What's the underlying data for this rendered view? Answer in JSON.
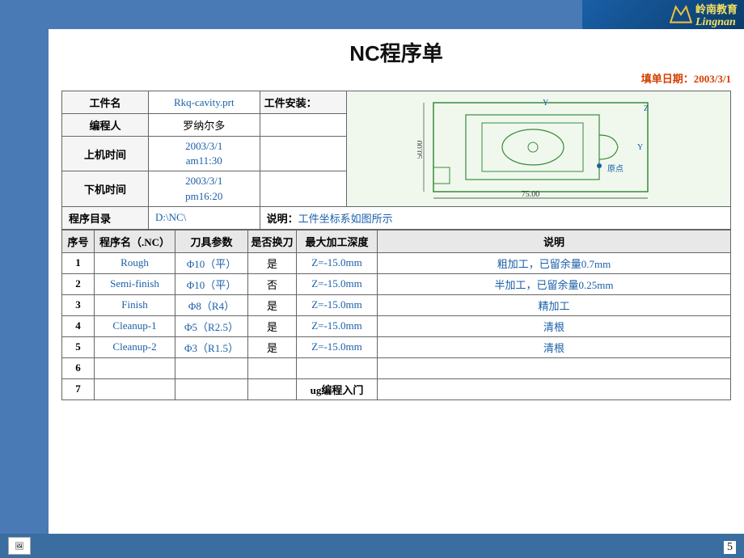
{
  "header": {
    "logo_text": "岭南教育",
    "logo_sub": "Lingnan"
  },
  "title": "NC程序单",
  "fill_date_label": "填单日期：",
  "fill_date_value": "2003/3/1",
  "info": {
    "part_name_label": "工件名",
    "part_name_value": "Rkq-cavity.prt",
    "install_label": "工件安装：",
    "programmer_label": "编程人",
    "programmer_value": "罗纳尔多",
    "start_time_label": "上机时间",
    "start_time_value": "2003/3/1 am11:30",
    "end_time_label": "下机时间",
    "end_time_value": "2003/3/1 pm16:20",
    "prog_dir_label": "程序目录",
    "prog_dir_value": "D:\\NC\\"
  },
  "note": {
    "label": "说明：",
    "text": "工件坐标系如图所示"
  },
  "table": {
    "headers": [
      "序号",
      "程序名（.NC）",
      "刀具参数",
      "是否换刀",
      "最大加工深度",
      "说明"
    ],
    "rows": [
      {
        "seq": "1",
        "prog": "Rough",
        "tool": "Φ10（平）",
        "change": "是",
        "depth": "Z=-15.0mm",
        "desc": "粗加工，已留余量0.7mm"
      },
      {
        "seq": "2",
        "prog": "Semi-finish",
        "tool": "Φ10（平）",
        "change": "否",
        "depth": "Z=-15.0mm",
        "desc": "半加工，已留余量0.25mm"
      },
      {
        "seq": "3",
        "prog": "Finish",
        "tool": "Φ8（R4）",
        "change": "是",
        "depth": "Z=-15.0mm",
        "desc": "精加工"
      },
      {
        "seq": "4",
        "prog": "Cleanup-1",
        "tool": "Φ5（R2.5）",
        "change": "是",
        "depth": "Z=-15.0mm",
        "desc": "清根"
      },
      {
        "seq": "5",
        "prog": "Cleanup-2",
        "tool": "Φ3（R1.5）",
        "change": "是",
        "depth": "Z=-15.0mm",
        "desc": "清根"
      },
      {
        "seq": "6",
        "prog": "",
        "tool": "",
        "change": "",
        "depth": "",
        "desc": ""
      },
      {
        "seq": "7",
        "prog": "",
        "tool": "",
        "change": "",
        "depth": "ug编程入门",
        "desc": ""
      }
    ]
  },
  "page_number": "5"
}
